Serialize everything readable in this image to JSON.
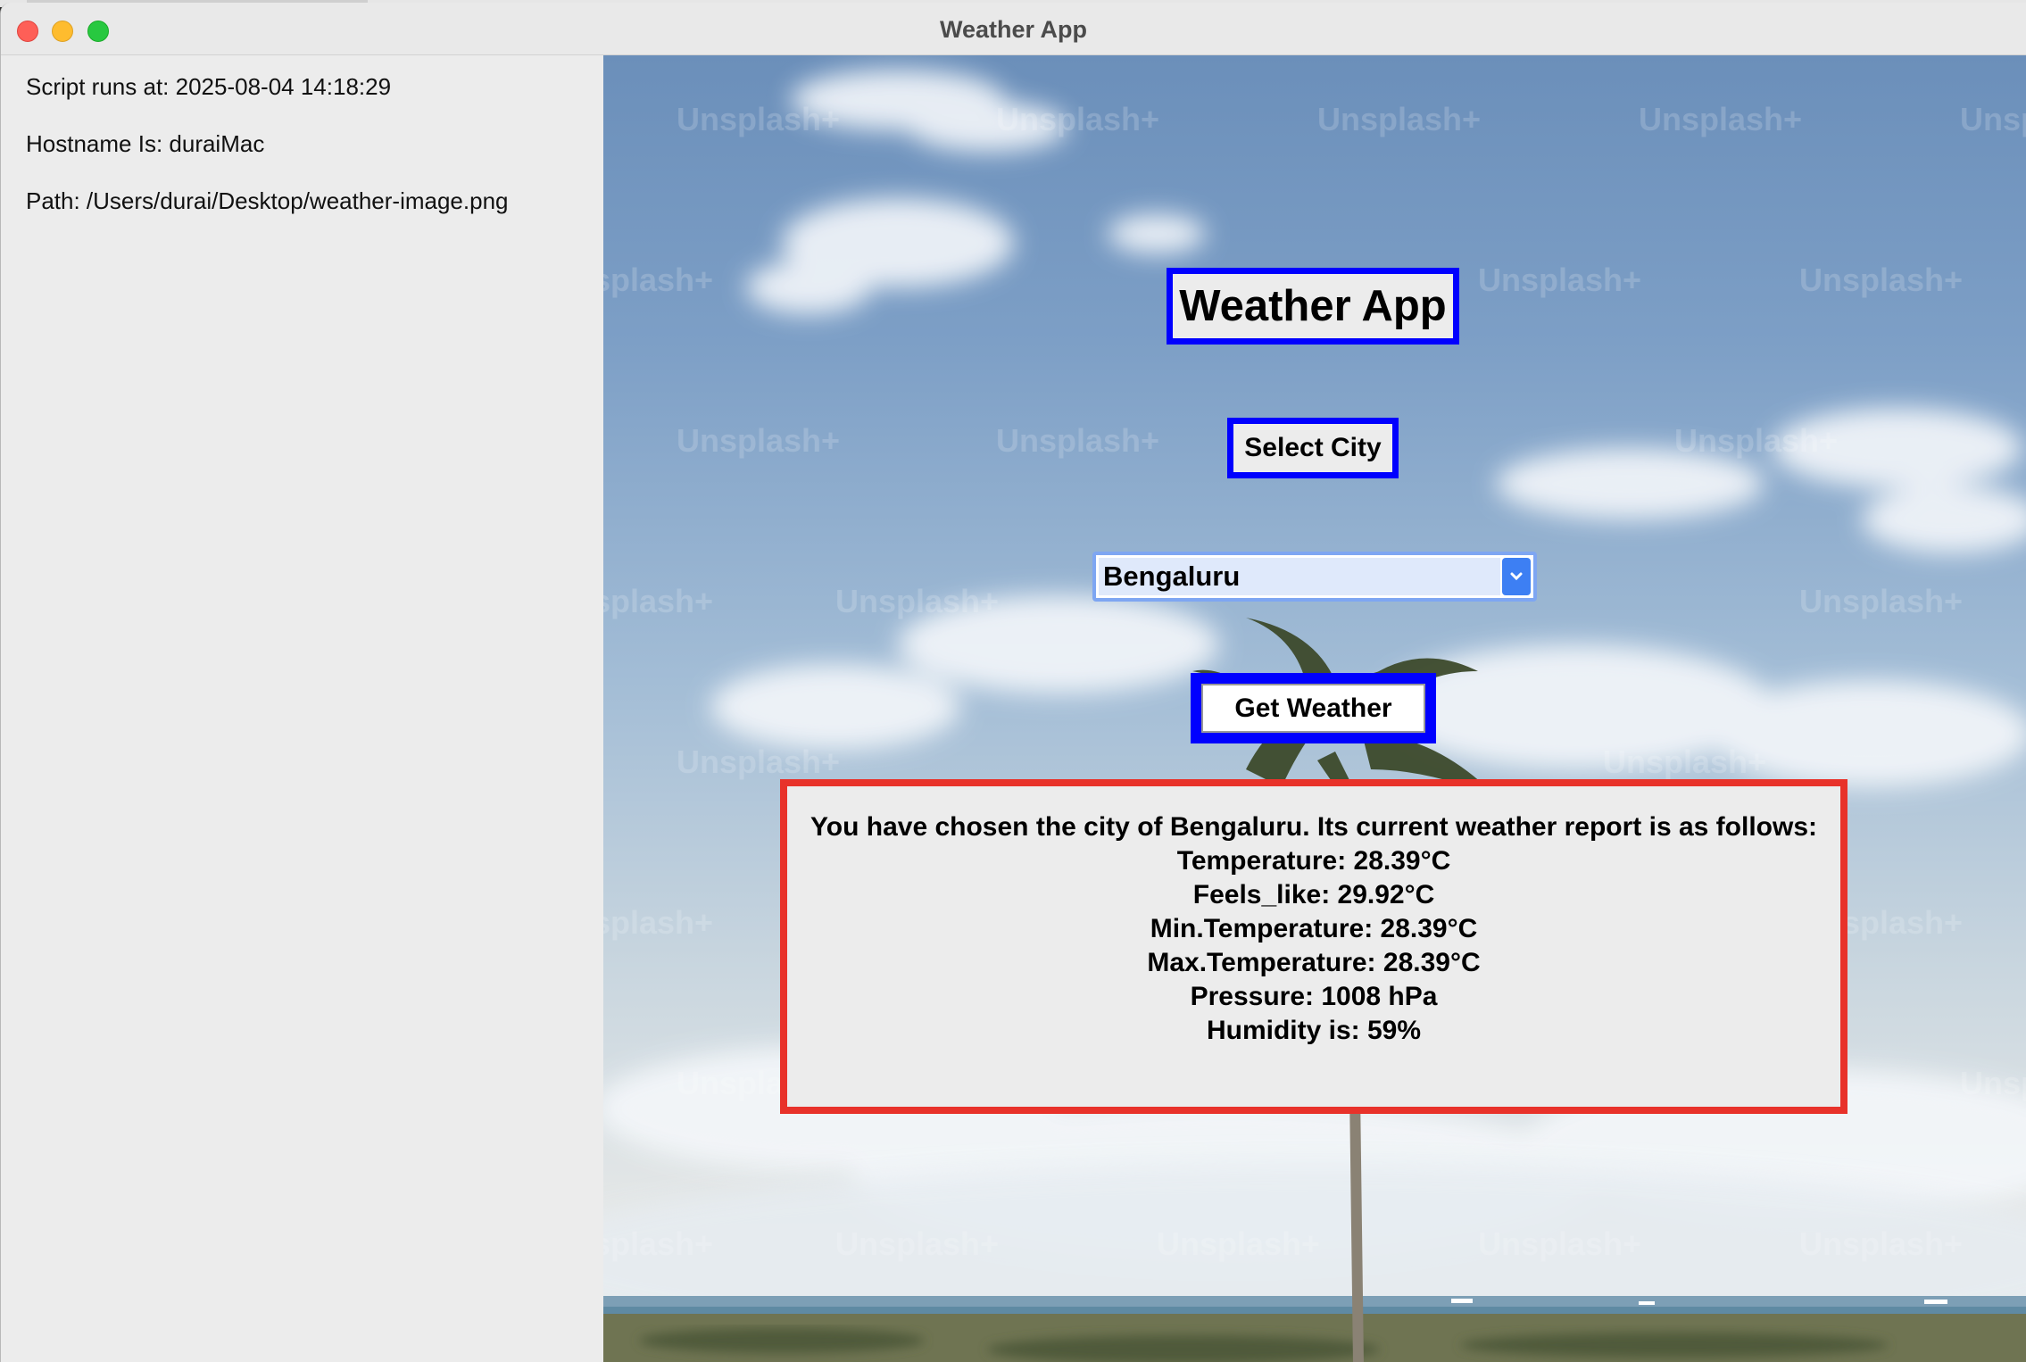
{
  "window": {
    "title": "Weather App"
  },
  "info": {
    "script_runs": "Script runs at: 2025-08-04 14:18:29",
    "hostname": "Hostname Is: duraiMac",
    "path": "Path: /Users/durai/Desktop/weather-image.png"
  },
  "main": {
    "heading": "Weather App",
    "select_label": "Select City",
    "city_value": "Bengaluru",
    "button_label": "Get Weather",
    "report": {
      "intro": "You have chosen the city of Bengaluru. Its current weather report is as follows:",
      "temperature": "Temperature: 28.39°C",
      "feels_like": "Feels_like: 29.92°C",
      "min_temp": "Min.Temperature: 28.39°C",
      "max_temp": "Max.Temperature: 28.39°C",
      "pressure": "Pressure: 1008 hPa",
      "humidity": "Humidity is: 59%"
    }
  },
  "background": {
    "watermark": "Unsplash+"
  },
  "colors": {
    "label_border": "#0000ff",
    "report_border": "#e8322a",
    "panel": "#ececec"
  },
  "icons": {
    "dropdown": "chevron-down-icon"
  }
}
